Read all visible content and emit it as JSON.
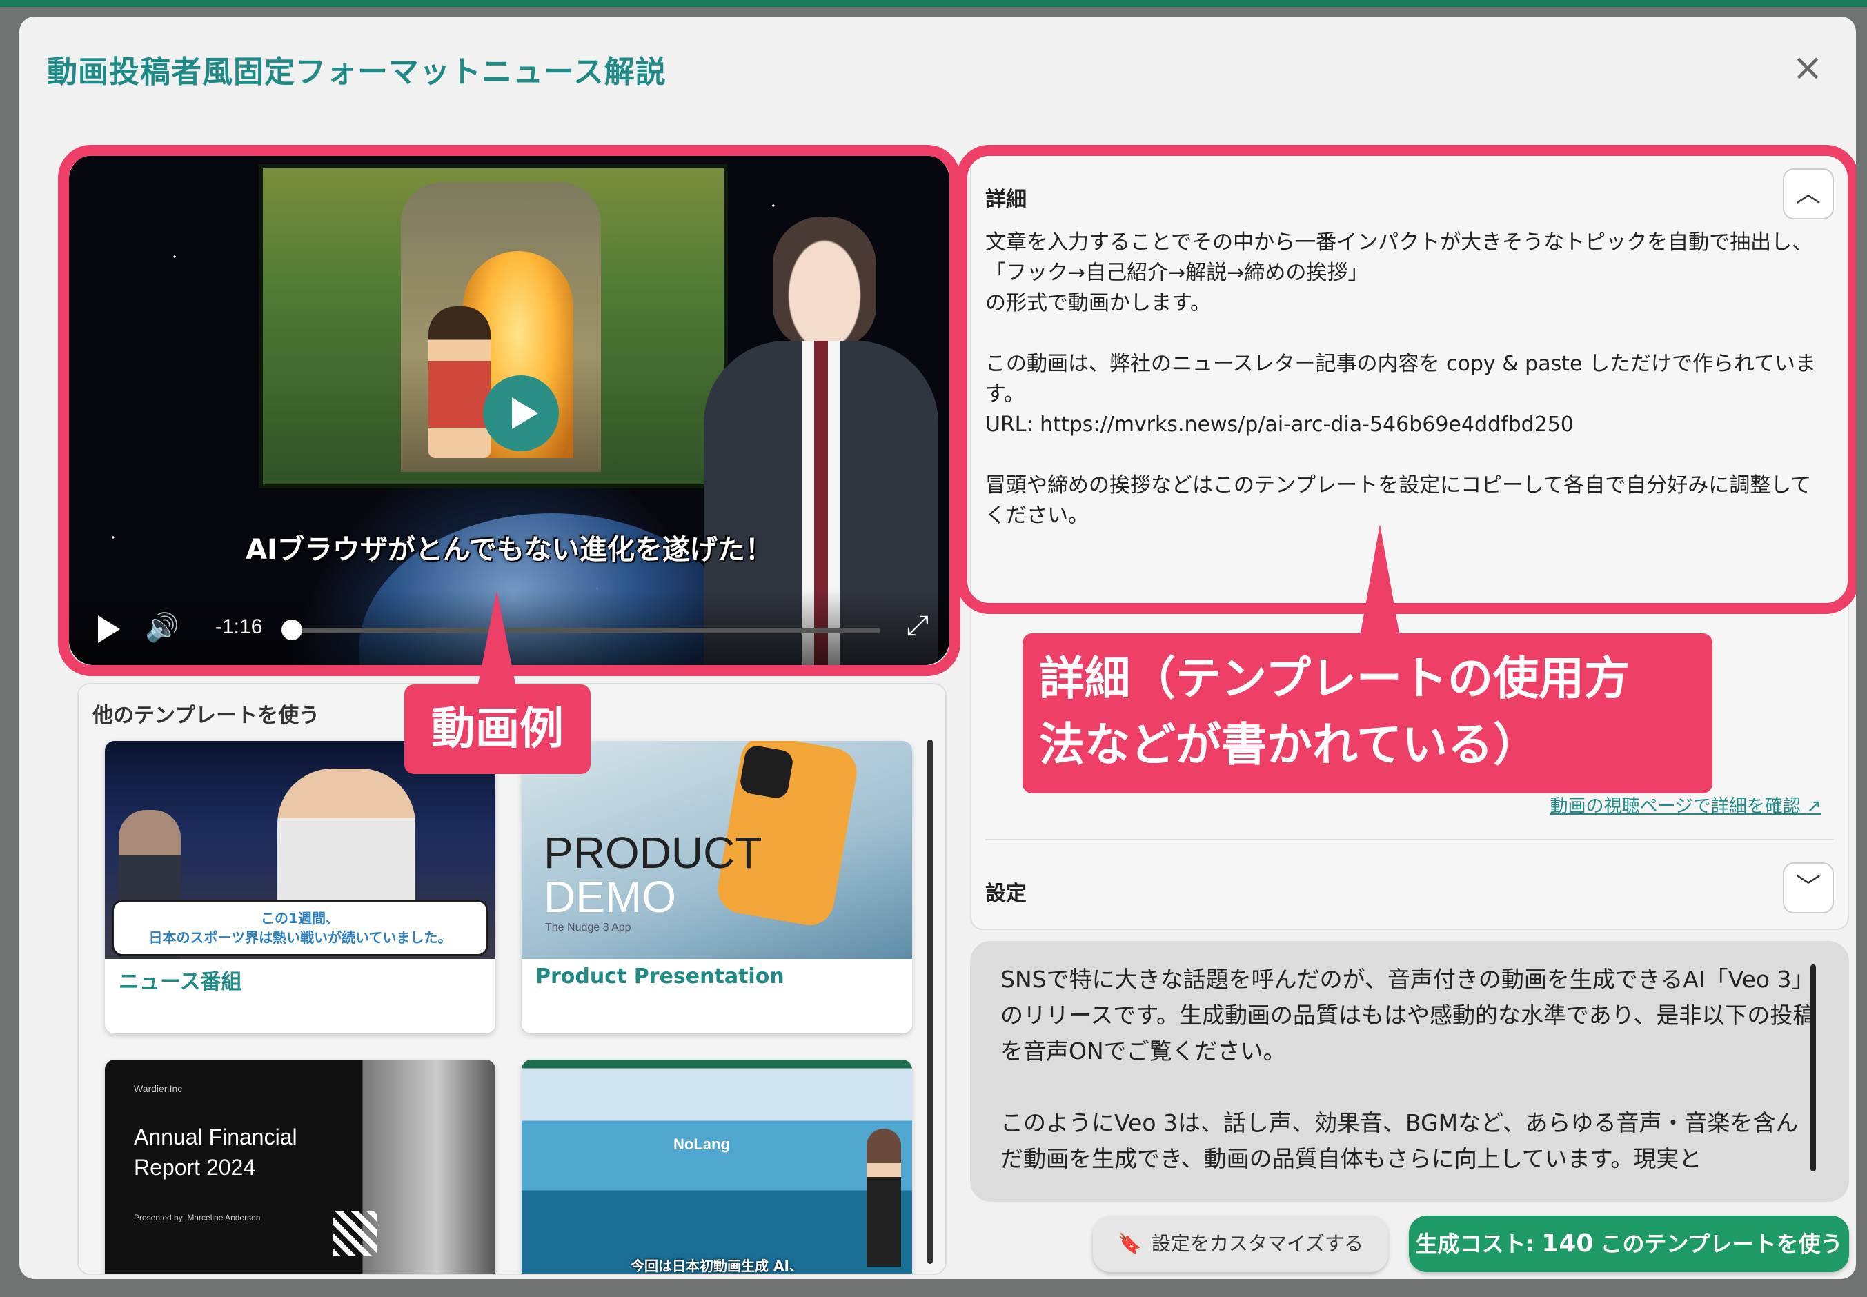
{
  "modal": {
    "title": "動画投稿者風固定フォーマットニュース解説",
    "close_label": "×"
  },
  "video": {
    "subtitle": "AIブラウザがとんでもない進化を遂げた！",
    "time_remaining": "-1:16",
    "progress_fraction": 0.0,
    "play_icon": "play-icon",
    "volume_icon": "volume-icon",
    "fullscreen_icon": "fullscreen-icon"
  },
  "annotations": {
    "video_example": "動画例",
    "details_note_line1": "詳細（テンプレートの使用方",
    "details_note_line2": "法などが書かれている）",
    "color": "#ee3f66"
  },
  "templates": {
    "heading": "他のテンプレートを使う",
    "cards": [
      {
        "label": "ニュース番組",
        "caption_line1": "この1週間、",
        "caption_line2": "日本のスポーツ界は熱い戦いが続いていました。"
      },
      {
        "label": "Product Presentation",
        "text1": "PRODUCT",
        "text2": "DEMO",
        "text3": "The Nudge 8 App"
      },
      {
        "label": "",
        "company": "Wardier.Inc",
        "title_line1": "Annual Financial",
        "title_line2": "Report 2024",
        "presenter": "Presented by: Marceline Anderson"
      },
      {
        "label": "",
        "logo": "NoLang",
        "caption": "今回は日本初動画生成 AI、"
      }
    ]
  },
  "details": {
    "title": "詳細",
    "body": "文章を入力することでその中から一番インパクトが大きそうなトピックを自動で抽出し、\n「フック→自己紹介→解説→締めの挨拶」\nの形式で動画かします。\n\nこの動画は、弊社のニュースレター記事の内容を copy & paste しただけで作られています。\nURL: https://mvrks.news/p/ai-arc-dia-546b69e4ddfbd250\n\n冒頭や締めの挨拶などはこのテンプレートを設定にコピーして各自で自分好みに調整してください。",
    "collapse_icon": "chevron-up-icon",
    "link_text": "動画の視聴ページで詳細を確認",
    "link_icon": "external-link-icon"
  },
  "settings": {
    "title": "設定",
    "expand_icon": "chevron-down-icon"
  },
  "input_text": "SNSで特に大きな話題を呼んだのが、音声付きの動画を生成できるAI「Veo 3」のリリースです。生成動画の品質はもはや感動的な水準であり、是非以下の投稿を音声ONでご覧ください。\n\nこのようにVeo 3は、話し声、効果音、BGMなど、あらゆる音声・音楽を含んだ動画を生成でき、動画の品質自体もさらに向上しています。現実と",
  "buttons": {
    "customize": "設定をカスタマイズする",
    "customize_icon": "bookmark-icon",
    "use_prefix": "生成コスト:",
    "use_cost": "140",
    "use_label": "このテンプレートを使う",
    "use_color": "#1e9a66"
  }
}
